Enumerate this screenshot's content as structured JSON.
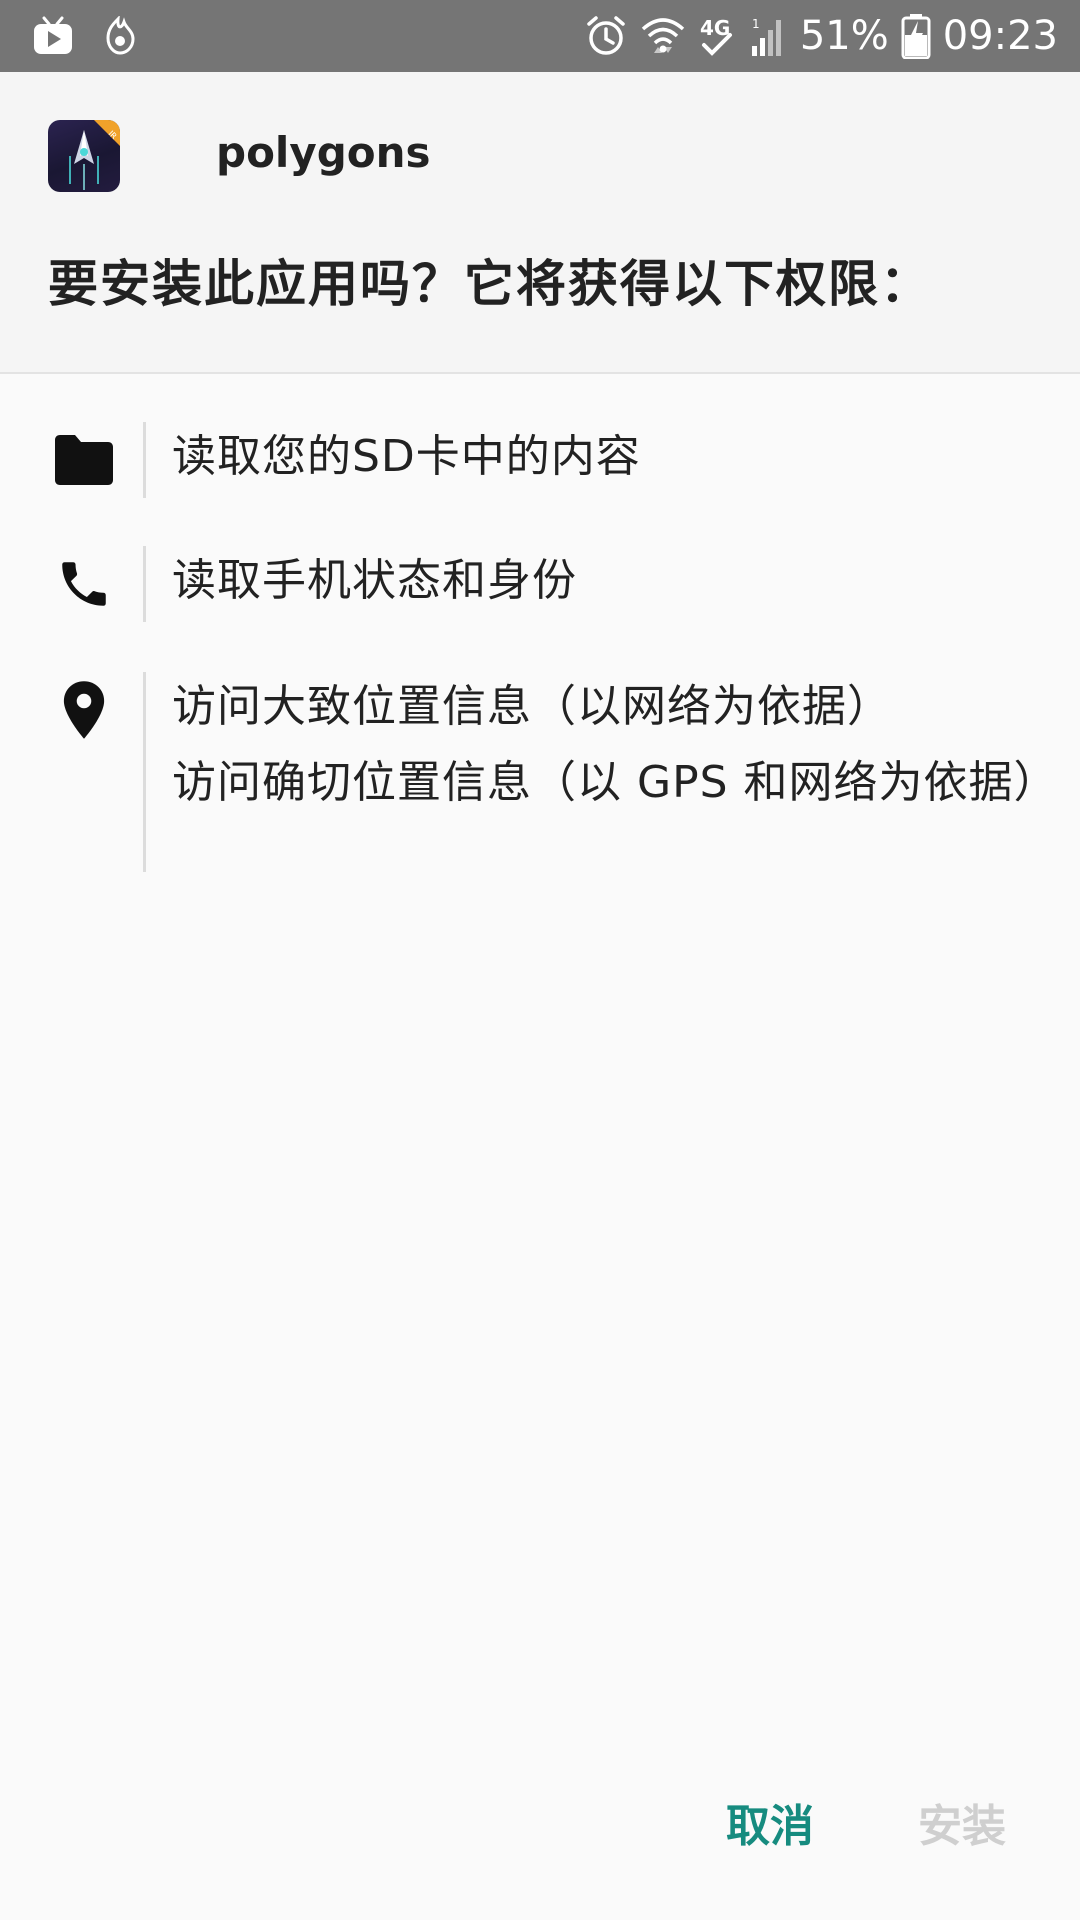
{
  "status_bar": {
    "left_icons": [
      "tv-app-icon",
      "notification-app-icon"
    ],
    "right_icons": [
      "alarm-icon",
      "wifi-icon",
      "4g-icon",
      "cell-signal-icon"
    ],
    "network_label": "4G",
    "battery_percent": "51%",
    "time": "09:23"
  },
  "header": {
    "app_icon": "polygons-app-icon",
    "app_name": "polygons",
    "question": "要安装此应用吗？它将获得以下权限："
  },
  "permissions": [
    {
      "icon": "folder-icon",
      "lines": [
        "读取您的SD卡中的内容"
      ]
    },
    {
      "icon": "phone-icon",
      "lines": [
        "读取手机状态和身份"
      ]
    },
    {
      "icon": "location-pin-icon",
      "lines": [
        "访问大致位置信息（以网络为依据）",
        "访问确切位置信息（以 GPS 和网络为依据）"
      ]
    }
  ],
  "buttons": {
    "cancel_label": "取消",
    "install_label": "安装"
  },
  "colors": {
    "status_bar": "#757575",
    "header_background": "#f5f5f5",
    "page_background": "#fafafa",
    "cancel_accent": "#168b7f",
    "install_disabled": "#cfcfcf"
  }
}
